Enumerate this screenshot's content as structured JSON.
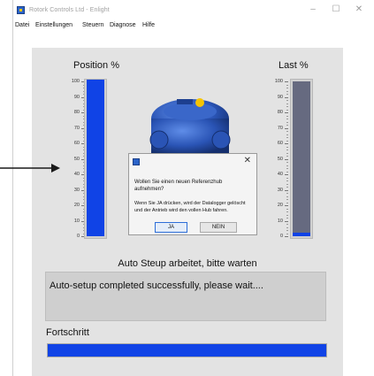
{
  "window": {
    "title": "Rotork Controls Ltd - Enlight",
    "minimize": "–",
    "maximize": "☐",
    "close": "✕"
  },
  "menu": [
    "Datei",
    "Einstellungen",
    "Steuern",
    "Diagnose",
    "Hilfe"
  ],
  "gauges": {
    "position": {
      "label": "Position %",
      "value_percent": 100,
      "color": "#1043e6"
    },
    "load": {
      "label": "Last %",
      "value_percent": 2,
      "track_color": "#666a80",
      "color": "#1043e6"
    },
    "ticks": [
      "100",
      "90",
      "80",
      "70",
      "60",
      "50",
      "40",
      "30",
      "20",
      "10",
      "0"
    ]
  },
  "status": {
    "caption": "Auto Steup arbeitet, bitte warten",
    "message": "Auto-setup completed successfully, please wait...."
  },
  "progress": {
    "label": "Fortschritt",
    "value_percent": 100,
    "color": "#1043e6"
  },
  "dialog": {
    "close": "✕",
    "message_line1": "Wollen Sie einen neuen Referenzhub aufnehmen?",
    "message_line2": "Wenn Sie JA drücken, wird der Datalogger gelöscht und der Antrieb wird den vollen Hub fahren.",
    "yes_label": "JA",
    "no_label": "NEIN"
  },
  "icons": {
    "app": "rotork-app-icon",
    "annotation": "arrow-icon"
  }
}
